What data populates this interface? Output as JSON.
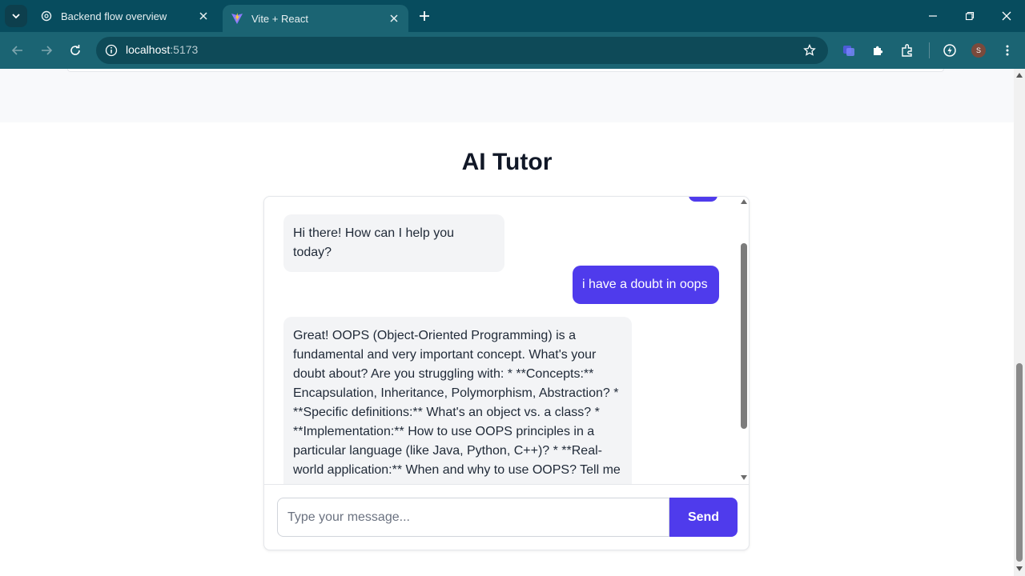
{
  "browser": {
    "tabs": [
      {
        "title": "Backend flow overview",
        "icon": "openai-icon",
        "active": false
      },
      {
        "title": "Vite + React",
        "icon": "vite-icon",
        "active": true
      }
    ],
    "address": {
      "host": "localhost",
      "port": ":5173"
    },
    "avatar_letter": "S",
    "theme_color": "#074c5e"
  },
  "page": {
    "title": "AI Tutor",
    "accent_color": "#4f3bec",
    "messages": [
      {
        "role": "bot",
        "text": "Hi there! How can I help you today?"
      },
      {
        "role": "user",
        "text": "i have a doubt in oops"
      },
      {
        "role": "bot",
        "text": "Great! OOPS (Object-Oriented Programming) is a fundamental and very important concept. What's your doubt about? Are you struggling with: * **Concepts:** Encapsulation, Inheritance, Polymorphism, Abstraction? * **Specific definitions:** What's an object vs. a class? * **Implementation:** How to use OOPS principles in a particular language (like Java, Python, C++)? * **Real-world application:** When and why to use OOPS? Tell me"
      }
    ],
    "composer": {
      "placeholder": "Type your message...",
      "value": "",
      "send_label": "Send"
    }
  }
}
